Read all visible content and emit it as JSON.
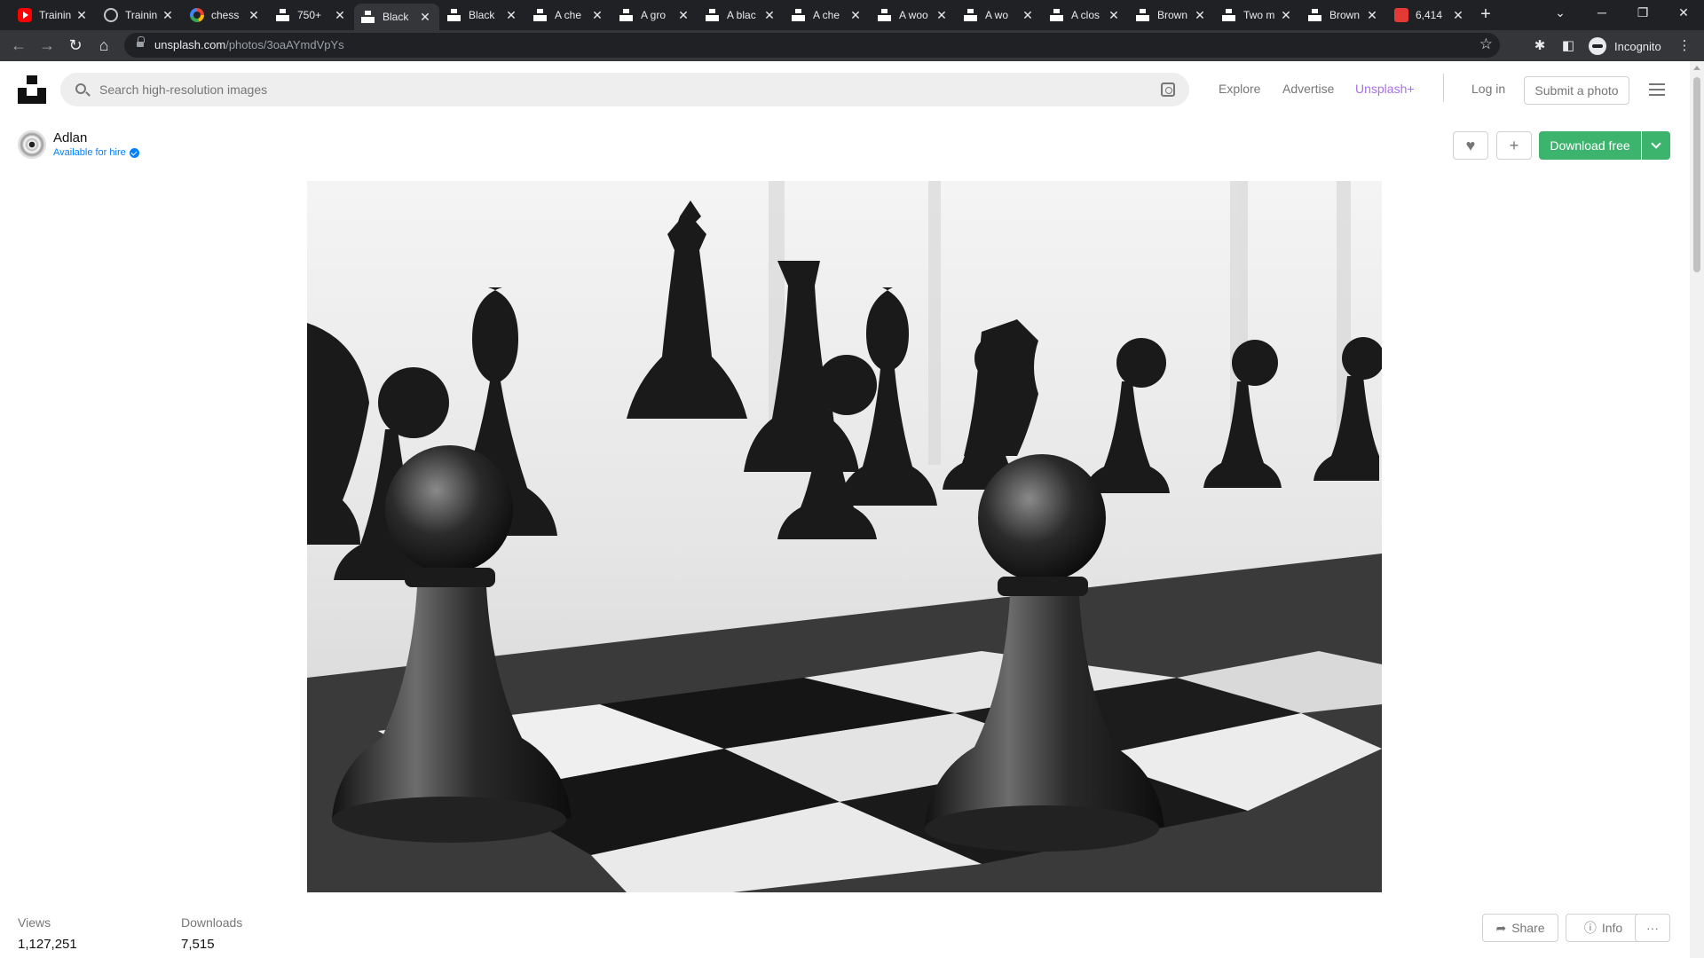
{
  "browser": {
    "tabs": [
      {
        "label": "Trainin",
        "icon": "youtube-icon"
      },
      {
        "label": "Trainin",
        "icon": "globe-icon"
      },
      {
        "label": "chess",
        "icon": "google-icon"
      },
      {
        "label": "750+",
        "icon": "unsplash-icon"
      },
      {
        "label": "Black",
        "icon": "unsplash-icon",
        "active": true
      },
      {
        "label": "Black",
        "icon": "unsplash-icon"
      },
      {
        "label": "A che",
        "icon": "unsplash-icon"
      },
      {
        "label": "A gro",
        "icon": "unsplash-icon"
      },
      {
        "label": "A blac",
        "icon": "unsplash-icon"
      },
      {
        "label": "A che",
        "icon": "unsplash-icon"
      },
      {
        "label": "A woo",
        "icon": "unsplash-icon"
      },
      {
        "label": "A wo",
        "icon": "unsplash-icon"
      },
      {
        "label": "A clos",
        "icon": "unsplash-icon"
      },
      {
        "label": "Brown",
        "icon": "unsplash-icon"
      },
      {
        "label": "Two m",
        "icon": "unsplash-icon"
      },
      {
        "label": "Brown",
        "icon": "unsplash-icon"
      },
      {
        "label": "6,414",
        "icon": "red-app-icon"
      }
    ],
    "url_domain": "unsplash.com",
    "url_path": "/photos/3oaAYmdVpYs",
    "profile_label": "Incognito"
  },
  "header": {
    "search_placeholder": "Search high-resolution images",
    "nav": {
      "explore": "Explore",
      "advertise": "Advertise",
      "plus": "Unsplash+"
    },
    "login": "Log in",
    "submit": "Submit a photo"
  },
  "author": {
    "name": "Adlan",
    "status": "Available for hire"
  },
  "actions": {
    "download": "Download free",
    "share": "Share",
    "info": "Info",
    "more": "···"
  },
  "stats": {
    "views_label": "Views",
    "views_value": "1,127,251",
    "downloads_label": "Downloads",
    "downloads_value": "7,515"
  },
  "colors": {
    "download_green": "#3cb46e",
    "plus_purple": "#a970e8",
    "hire_blue": "#007fff"
  }
}
